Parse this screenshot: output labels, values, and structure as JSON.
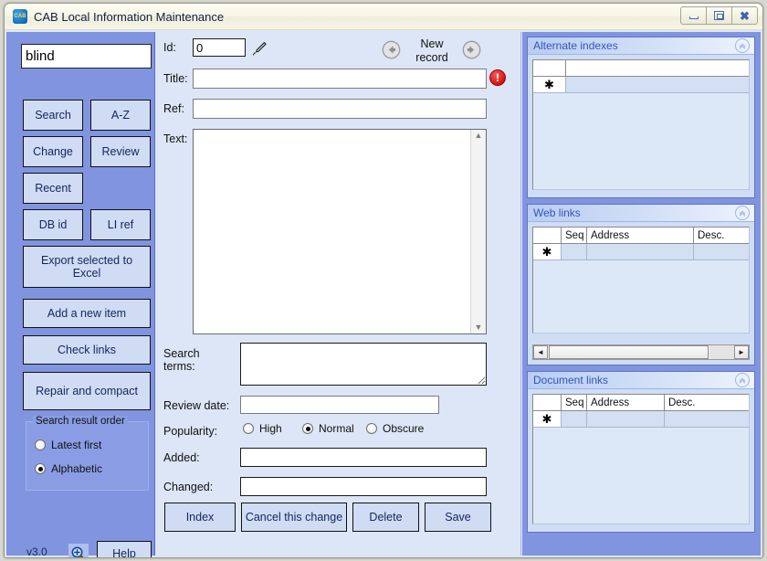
{
  "window": {
    "title": "CAB Local Information Maintenance",
    "app_icon": "cab-app-icon",
    "icon_text": "CAB",
    "controls": {
      "minimize": "minimize-icon",
      "restore": "restore-icon",
      "close": "close-icon",
      "close_glyph": "✖"
    }
  },
  "sidebar": {
    "search_value": "blind",
    "search_placeholder": "",
    "buttons": [
      {
        "label": "Search",
        "name": "search-button"
      },
      {
        "label": "A-Z",
        "name": "a-z-button"
      },
      {
        "label": "Change",
        "name": "change-button"
      },
      {
        "label": "Review",
        "name": "review-button"
      },
      {
        "label": "Recent",
        "name": "recent-button"
      },
      {
        "label": "DB id",
        "name": "db-id-button"
      },
      {
        "label": "LI ref",
        "name": "li-ref-button"
      },
      {
        "label": "Export selected to Excel",
        "name": "export-to-excel-button"
      },
      {
        "label": "Add a new item",
        "name": "add-new-item-button"
      },
      {
        "label": "Check links",
        "name": "check-links-button"
      },
      {
        "label": "Repair and compact",
        "name": "repair-and-compact-button"
      }
    ],
    "group": {
      "title": "Search result order",
      "options": [
        {
          "label": "Latest first",
          "selected": false
        },
        {
          "label": "Alphabetic",
          "selected": true
        }
      ]
    },
    "version": "v3.0",
    "zoom_icon": "magnifier-plus-icon",
    "help_label": "Help"
  },
  "main": {
    "labels": {
      "id": "Id:",
      "title": "Title:",
      "ref": "Ref:",
      "text": "Text:",
      "search_terms": "Search\nterms:",
      "search_terms_line1": "Search",
      "search_terms_line2": "terms:",
      "review_date": "Review date:",
      "popularity": "Popularity:",
      "added": "Added:",
      "changed": "Changed:"
    },
    "values": {
      "id": "0",
      "title": "",
      "ref": "",
      "text": "",
      "search_terms": "",
      "review_date": "",
      "added": "",
      "changed": ""
    },
    "nav": {
      "new_record_label_line1": "New",
      "new_record_label_line2": "record",
      "prev_icon": "arrow-left-circle-icon",
      "next_icon": "arrow-right-circle-icon"
    },
    "edit_icon": "pencil-icon",
    "error_badge": {
      "name": "title-error-badge",
      "glyph": "!",
      "color": "#d81616"
    },
    "popularity_options": [
      {
        "label": "High",
        "selected": false
      },
      {
        "label": "Normal",
        "selected": true
      },
      {
        "label": "Obscure",
        "selected": false
      }
    ],
    "buttons": [
      {
        "label": "Index",
        "name": "index-button"
      },
      {
        "label": "Cancel this change",
        "name": "cancel-this-change-button"
      },
      {
        "label": "Delete",
        "name": "delete-button"
      },
      {
        "label": "Save",
        "name": "save-button"
      }
    ],
    "scrollbar": {
      "up": "▲",
      "down": "▼"
    }
  },
  "right_panels": [
    {
      "title": "Alternate indexes",
      "name": "alternate-indexes-panel",
      "collapse_icon": "chevron-up-circle-icon",
      "collapse_glyph": "«",
      "columns": [
        ""
      ],
      "row_marker": "✱",
      "has_hscroll": false
    },
    {
      "title": "Web links",
      "name": "web-links-panel",
      "collapse_icon": "chevron-up-circle-icon",
      "collapse_glyph": "«",
      "columns": [
        "",
        "Seq",
        "Address",
        "Desc."
      ],
      "row_marker": "✱",
      "has_hscroll": true,
      "hscroll": {
        "left_glyph": "◄",
        "right_glyph": "►"
      }
    },
    {
      "title": "Document links",
      "name": "document-links-panel",
      "collapse_icon": "chevron-up-circle-icon",
      "collapse_glyph": "«",
      "columns": [
        "",
        "Seq",
        "Address",
        "Desc."
      ],
      "row_marker": "✱",
      "has_hscroll": false
    }
  ],
  "colors": {
    "sidebar_bg": "#8094e0",
    "form_bg": "#dce6f7",
    "button_bg": "#cfdcf4",
    "button_text": "#14255e",
    "panel_title": "#3355bb",
    "error_red": "#d81616"
  }
}
